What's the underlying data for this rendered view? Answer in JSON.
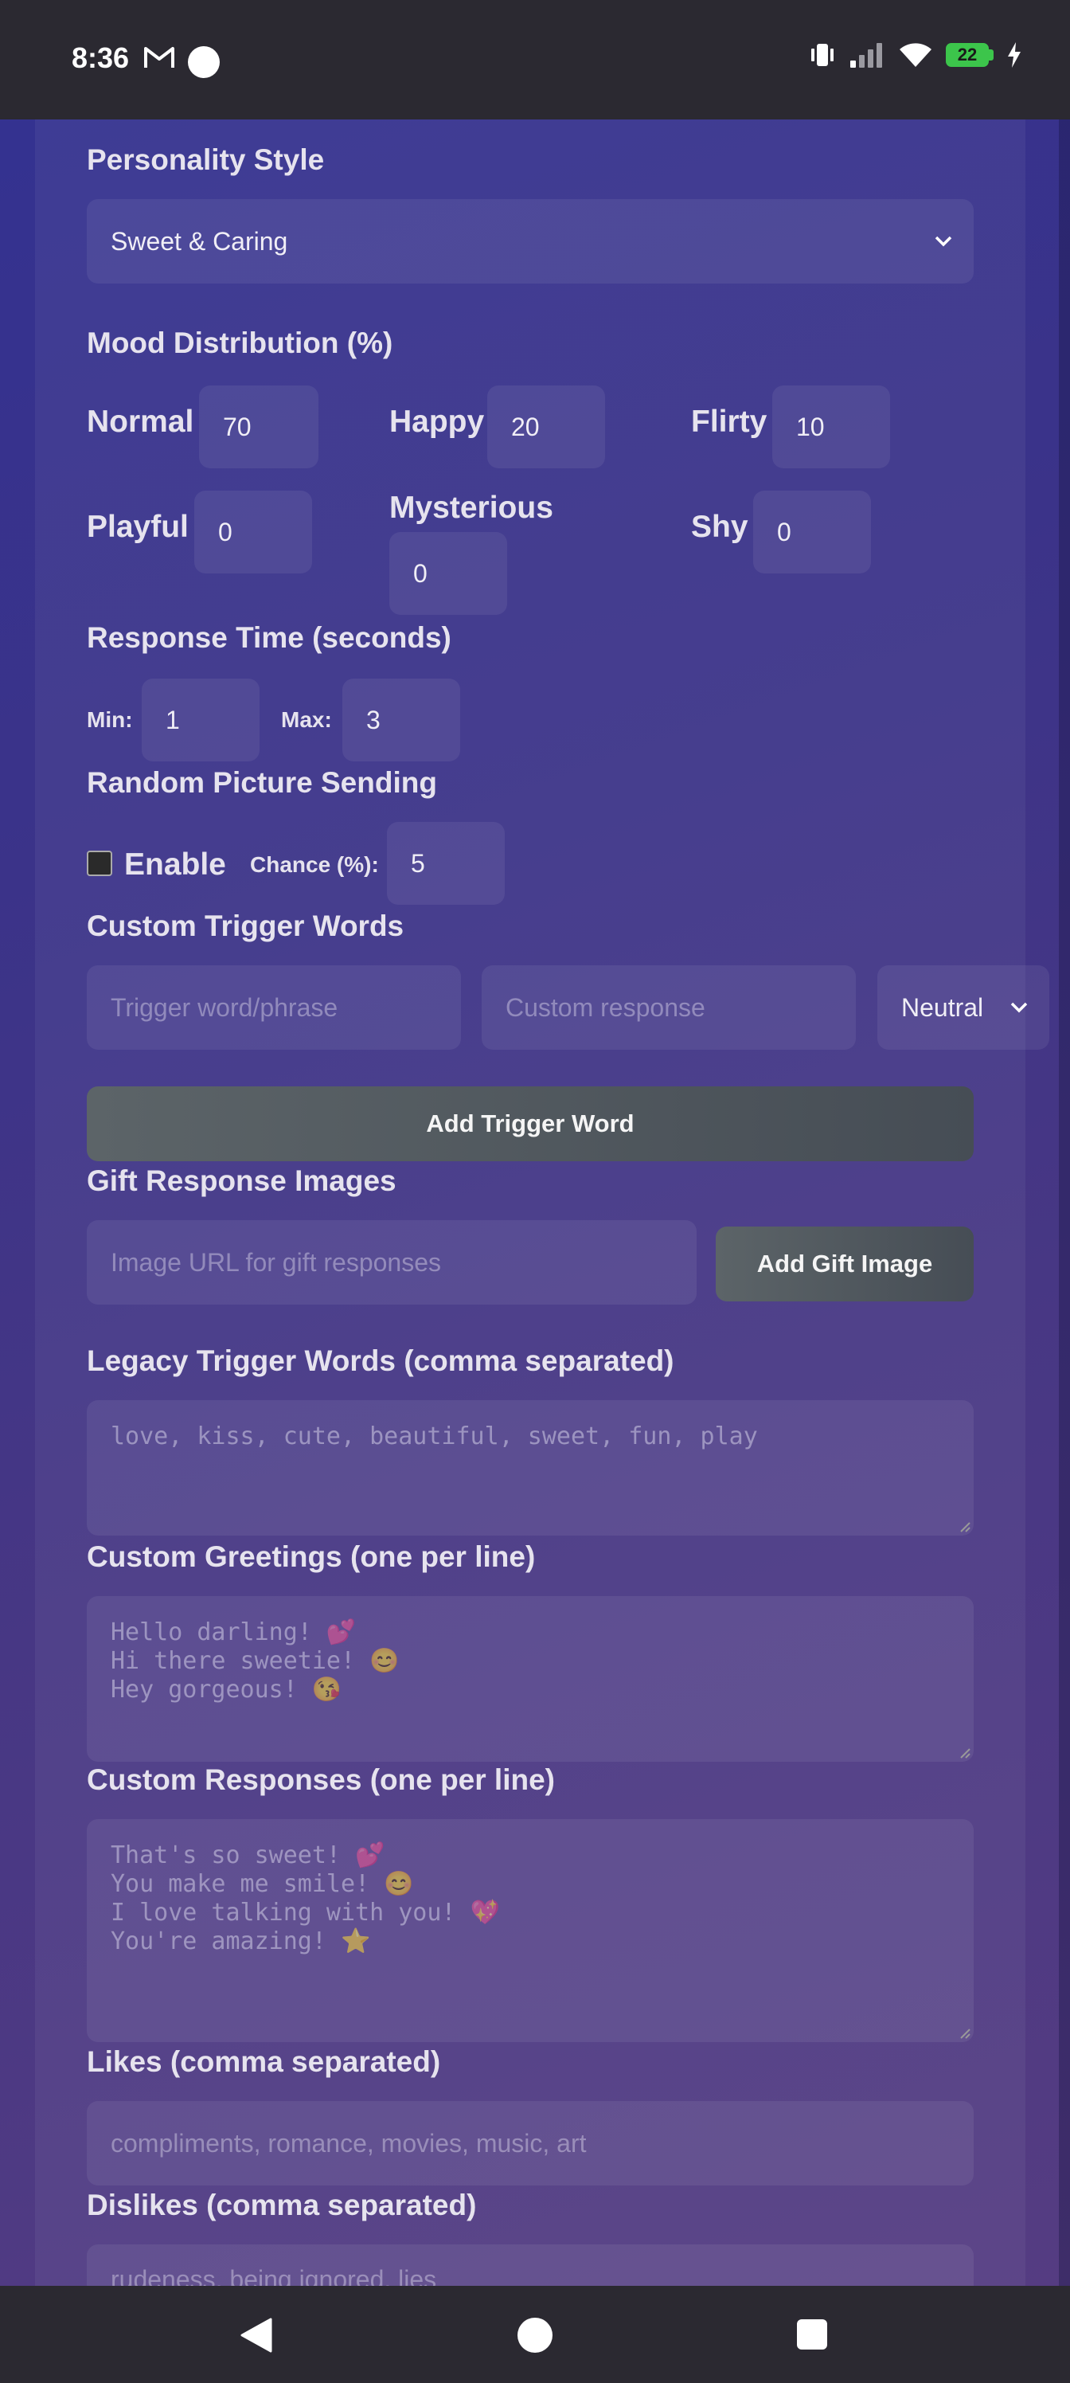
{
  "status_bar": {
    "time": "8:36",
    "battery_level": "22"
  },
  "form": {
    "personality_style": {
      "label": "Personality Style",
      "value": "Sweet & Caring"
    },
    "mood_distribution": {
      "label": "Mood Distribution (%)",
      "moods": [
        {
          "label": "Normal",
          "value": "70"
        },
        {
          "label": "Happy",
          "value": "20"
        },
        {
          "label": "Flirty",
          "value": "10"
        },
        {
          "label": "Playful",
          "value": "0"
        },
        {
          "label": "Mysterious",
          "value": "0"
        },
        {
          "label": "Shy",
          "value": "0"
        }
      ]
    },
    "response_time": {
      "label": "Response Time (seconds)",
      "min_label": "Min:",
      "min_value": "1",
      "max_label": "Max:",
      "max_value": "3"
    },
    "random_picture": {
      "label": "Random Picture Sending",
      "enable_label": "Enable",
      "enabled": false,
      "chance_label": "Chance (%):",
      "chance_value": "5"
    },
    "custom_trigger_words": {
      "label": "Custom Trigger Words",
      "trigger_placeholder": "Trigger word/phrase",
      "response_placeholder": "Custom response",
      "mood_value": "Neutral",
      "add_button": "Add Trigger Word"
    },
    "gift_response_images": {
      "label": "Gift Response Images",
      "url_placeholder": "Image URL for gift responses",
      "add_button": "Add Gift Image"
    },
    "legacy_trigger_words": {
      "label": "Legacy Trigger Words (comma separated)",
      "placeholder": "love, kiss, cute, beautiful, sweet, fun, play"
    },
    "custom_greetings": {
      "label": "Custom Greetings (one per line)",
      "placeholder": "Hello darling! 💕\nHi there sweetie! 😊\nHey gorgeous! 😘"
    },
    "custom_responses": {
      "label": "Custom Responses (one per line)",
      "placeholder": "That's so sweet! 💕\nYou make me smile! 😊\nI love talking with you! 💖\nYou're amazing! ⭐"
    },
    "likes": {
      "label": "Likes (comma separated)",
      "placeholder": "compliments, romance, movies, music, art"
    },
    "dislikes": {
      "label": "Dislikes (comma separated)",
      "placeholder": "rudeness, being ignored, lies"
    }
  }
}
